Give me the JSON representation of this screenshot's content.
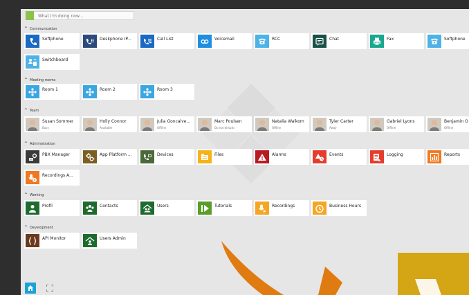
{
  "status": {
    "placeholder": "What I'm doing now..."
  },
  "colors": {
    "page_bg": "#2e2e2e",
    "panel_bg": "#e6e6e6",
    "status_green": "#8bc34a"
  },
  "sections": {
    "communication": "Communication",
    "meeting_rooms": "Meeting rooms",
    "team": "Team",
    "administration": "Administration",
    "working": "Working",
    "development": "Development"
  },
  "communication": [
    {
      "label": "Softphone",
      "icon": "phone-icon",
      "color": "#1a69c2"
    },
    {
      "label": "Deskphone IP...",
      "icon": "deskphone-icon",
      "color": "#2c4a7c"
    },
    {
      "label": "Call List",
      "icon": "call-list-icon",
      "color": "#1a69c2"
    },
    {
      "label": "Voicemail",
      "icon": "voicemail-icon",
      "color": "#1e8ee0"
    },
    {
      "label": "RCC",
      "icon": "desk-telephone-icon",
      "color": "#4db3e6"
    },
    {
      "label": "Chat",
      "icon": "chat-icon",
      "color": "#17524a"
    },
    {
      "label": "Fax",
      "icon": "fax-icon",
      "color": "#17a88f"
    },
    {
      "label": "Softphone",
      "icon": "desk-telephone-icon",
      "color": "#4db3e6"
    },
    {
      "label": "Switchboard",
      "icon": "switchboard-icon",
      "color": "#4db3e6"
    }
  ],
  "meeting_rooms": [
    {
      "label": "Room 1",
      "icon": "room-icon",
      "color": "#3ba6e0"
    },
    {
      "label": "Room 2",
      "icon": "room-icon",
      "color": "#3ba6e0"
    },
    {
      "label": "Room 3",
      "icon": "room-icon",
      "color": "#3ba6e0"
    }
  ],
  "team": [
    {
      "name": "Susan Sommer",
      "status": "Busy",
      "status_color": "#e84e3c"
    },
    {
      "name": "Holly Connor",
      "status": "Available",
      "status_color": "#4caf50"
    },
    {
      "name": "Julia Goncalve...",
      "status": "Offline",
      "status_color": "#bdbdbd"
    },
    {
      "name": "Marc Poulsen",
      "status": "Do not disturb",
      "status_color": "#e84e3c"
    },
    {
      "name": "Natalia Walkom",
      "status": "Offline",
      "status_color": "#bdbdbd"
    },
    {
      "name": "Tyler Carter",
      "status": "Away",
      "status_color": "#f5a623"
    },
    {
      "name": "Gabriel Lyons",
      "status": "Offline",
      "status_color": "#bdbdbd"
    },
    {
      "name": "Benjamin O",
      "status": "Offline",
      "status_color": "#bdbdbd"
    }
  ],
  "administration": [
    {
      "label": "PBX Manager",
      "icon": "pbx-manager-icon",
      "color": "#3a3a3a"
    },
    {
      "label": "App Platform ...",
      "icon": "gears-icon",
      "color": "#7a5f24"
    },
    {
      "label": "Devices",
      "icon": "devices-icon",
      "color": "#4a6a3a"
    },
    {
      "label": "Files",
      "icon": "files-icon",
      "color": "#f5b31a"
    },
    {
      "label": "Alarms",
      "icon": "alarm-icon",
      "color": "#b81c22"
    },
    {
      "label": "Events",
      "icon": "events-icon",
      "color": "#e43d2f"
    },
    {
      "label": "Logging",
      "icon": "logging-icon",
      "color": "#e43d2f"
    },
    {
      "label": "Reports",
      "icon": "reports-icon",
      "color": "#f07820"
    },
    {
      "label": "Recordings A...",
      "icon": "recordings-admin-icon",
      "color": "#f07820"
    }
  ],
  "working": [
    {
      "label": "Profil",
      "icon": "profile-icon",
      "color": "#1e6b2f"
    },
    {
      "label": "Contacts",
      "icon": "contacts-icon",
      "color": "#1e6b2f"
    },
    {
      "label": "Users",
      "icon": "users-icon",
      "color": "#1e6b2f"
    },
    {
      "label": "Tutorials",
      "icon": "tutorials-icon",
      "color": "#5a9e2a"
    },
    {
      "label": "Recordings",
      "icon": "recordings-icon",
      "color": "#f5a623"
    },
    {
      "label": "Business Hours",
      "icon": "business-hours-icon",
      "color": "#f5a623"
    }
  ],
  "development": [
    {
      "label": "API Monitor",
      "icon": "api-monitor-icon",
      "color": "#6b3a1e"
    },
    {
      "label": "Users Admin",
      "icon": "users-admin-icon",
      "color": "#1e6b2f"
    }
  ],
  "bottom": {
    "home_icon": "home-icon",
    "fullscreen_icon": "fullscreen-icon"
  }
}
